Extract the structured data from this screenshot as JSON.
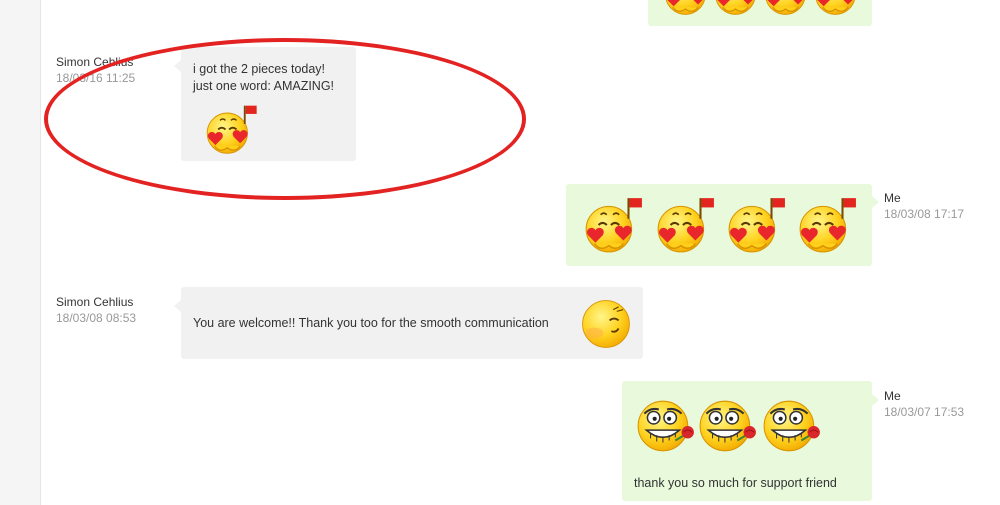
{
  "messages": [
    {
      "sender": "Simon Cehlius",
      "time": "18/03/16 11:25",
      "line1": "i got the 2 pieces today!",
      "line2": "just one word: AMAZING!"
    },
    {
      "sender": "Me",
      "time": "18/03/08 17:17"
    },
    {
      "sender": "Simon Cehlius",
      "time": "18/03/08 08:53",
      "text": "You are welcome!! Thank you too for the smooth communication"
    },
    {
      "sender": "Me",
      "time": "18/03/07 17:53",
      "text": "thank you so much for support friend"
    }
  ],
  "colors": {
    "incoming_bubble": "#f1f1f1",
    "outgoing_bubble": "#e8f9dc",
    "highlight_circle": "#e32222"
  },
  "icons": {
    "kiss": "kiss-heart-flag-emoticon",
    "smile": "smug-smile-emoticon",
    "rose": "grin-rose-emoticon"
  }
}
